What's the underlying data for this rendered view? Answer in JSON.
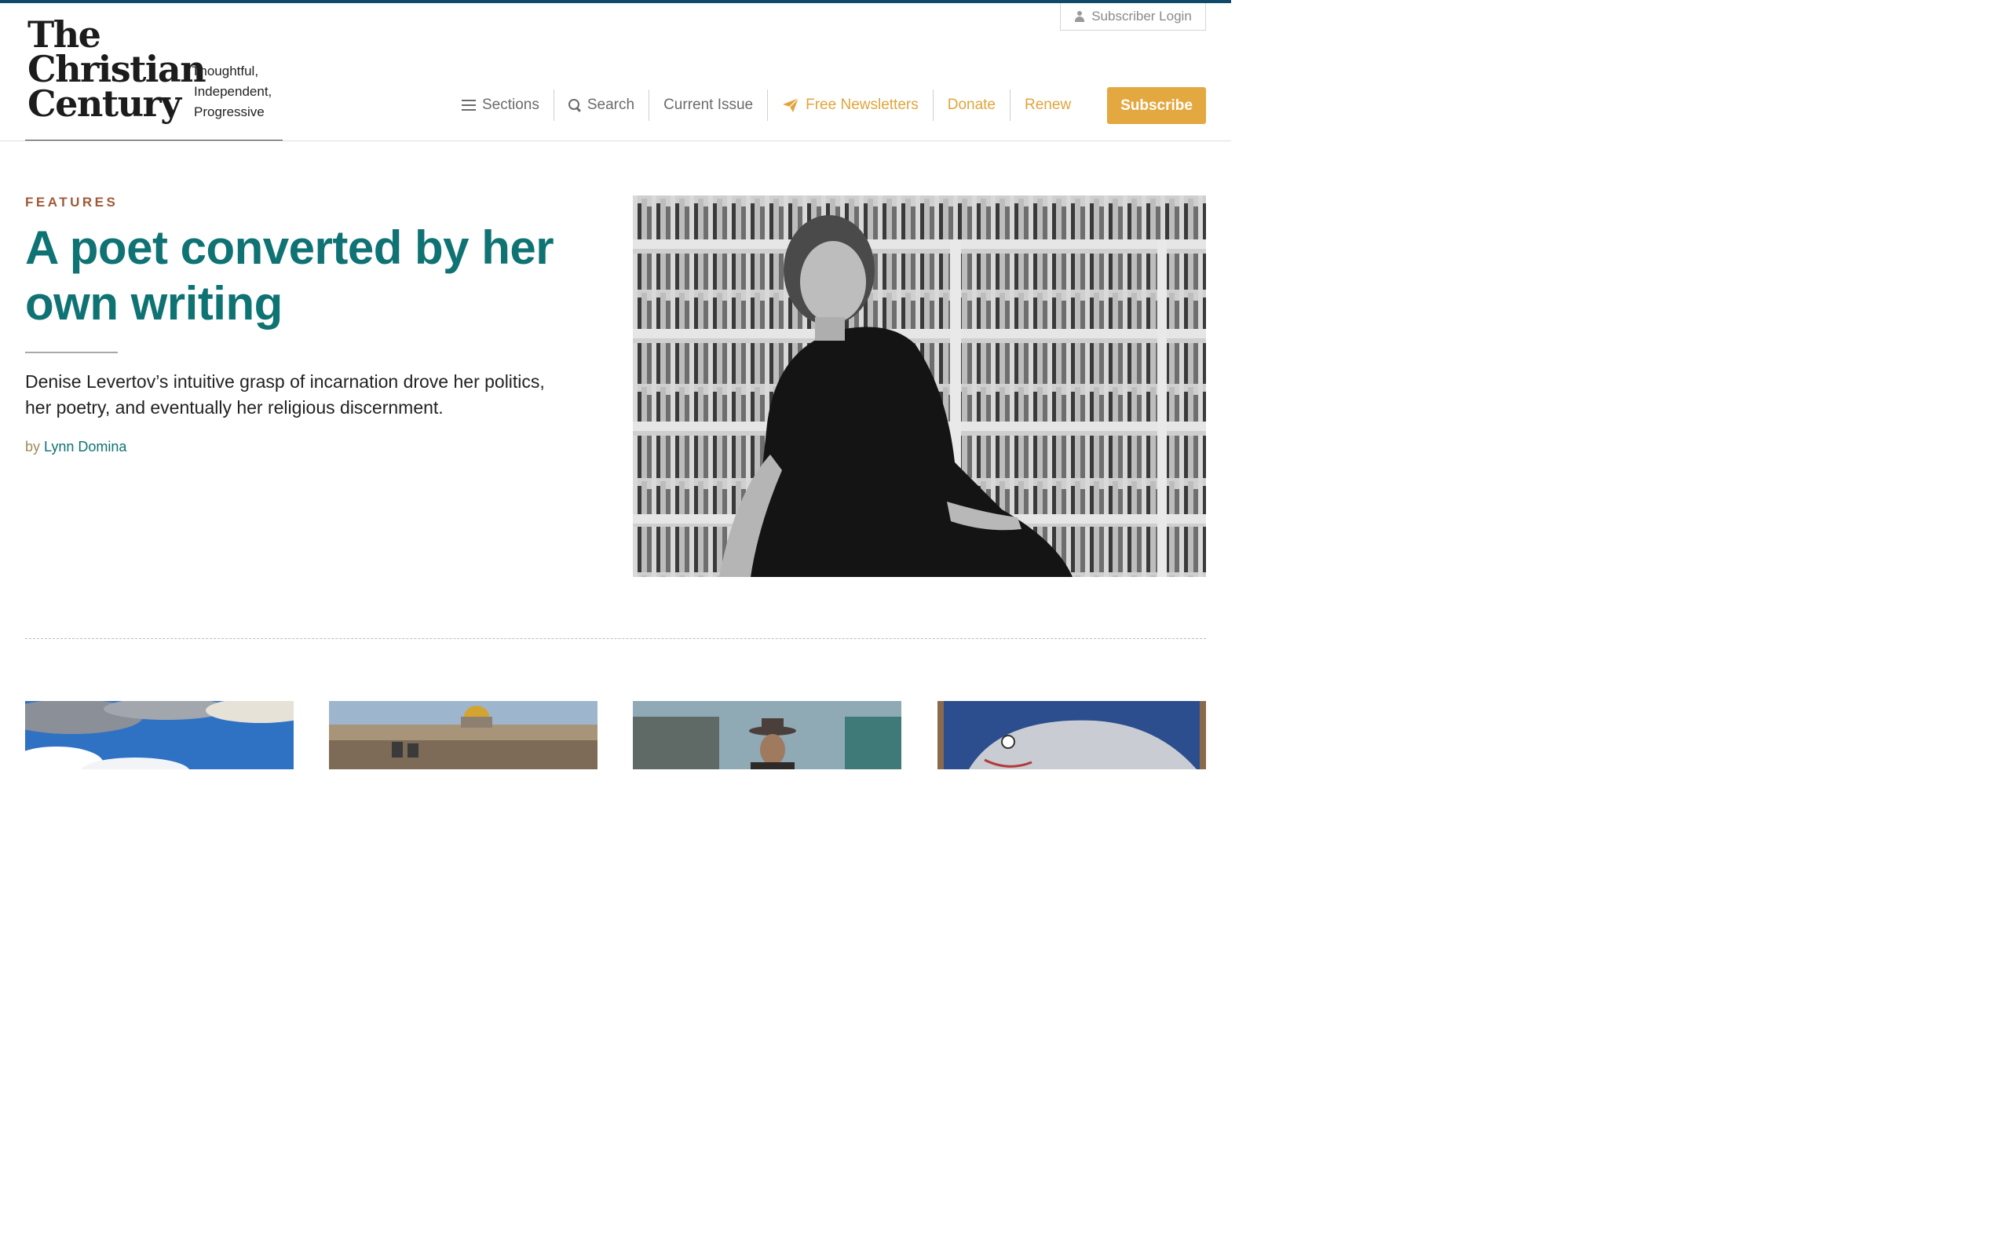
{
  "site": {
    "logo_line1": "The",
    "logo_line2": "Christian",
    "logo_line3": "Century",
    "tagline_line1": "Thoughtful,",
    "tagline_line2": "Independent,",
    "tagline_line3": "Progressive"
  },
  "header": {
    "login_label": "Subscriber Login",
    "nav": {
      "sections": "Sections",
      "search": "Search",
      "current_issue": "Current Issue",
      "newsletters": "Free Newsletters",
      "donate": "Donate",
      "renew": "Renew"
    },
    "subscribe_label": "Subscribe"
  },
  "feature": {
    "kicker": "FEATURES",
    "headline": "A poet converted by her own writing",
    "dek": "Denise Levertov’s intuitive grasp of incarnation drove her politics, her poetry, and eventually her religious discernment.",
    "by": "by",
    "author": "Lynn Domina"
  },
  "colors": {
    "brand_teal": "#0f7273",
    "accent_gold": "#e4a840",
    "kicker_rust": "#a05a3a",
    "top_bar": "#0f4a6b"
  }
}
